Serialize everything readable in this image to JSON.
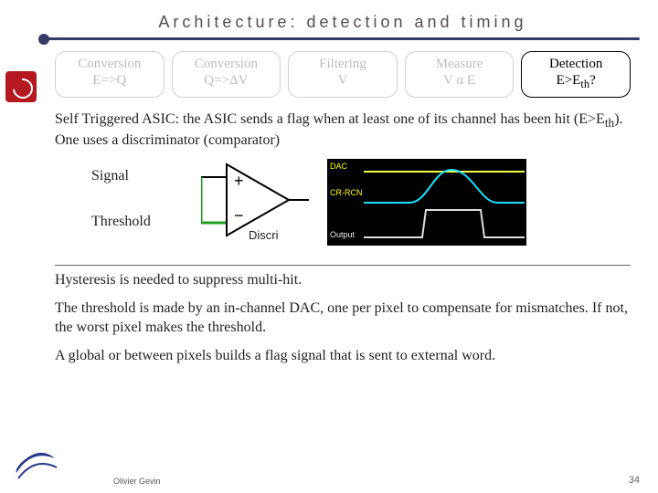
{
  "title": "Architecture: detection and timing",
  "pipeline": [
    {
      "line1": "Conversion",
      "line2": "E=>Q",
      "dimmed": true
    },
    {
      "line1": "Conversion",
      "line2": "Q=>ΔV",
      "dimmed": true
    },
    {
      "line1": "Filtering",
      "line2": "V",
      "dimmed": true
    },
    {
      "line1": "Measure",
      "line2": "V α E",
      "dimmed": true
    },
    {
      "line1": "Detection",
      "line2_html": "E>E<sub>th</sub>?",
      "dimmed": false
    }
  ],
  "para1_html": "Self Triggered ASIC: the ASIC sends a flag when at least one of its channel has been hit (E>E<sub>th</sub>). One uses a discriminator (comparator)",
  "diagram": {
    "signal_label": "Signal",
    "threshold_label": "Threshold",
    "opamp_in_plus": "+",
    "opamp_in_minus": "−",
    "discri_label": "Discri",
    "scope": {
      "dac": "DAC",
      "crrc": "CR-RCN",
      "output": "Output"
    }
  },
  "para2": "Hysteresis is needed to suppress multi-hit.",
  "para3": "The threshold is made by an in-channel DAC, one per pixel to compensate for mismatches. If not, the worst pixel makes the threshold.",
  "para4": "A global or between pixels builds a flag signal that is sent to external word.",
  "footer": {
    "author": "Olivier Gevin",
    "page": "34"
  }
}
